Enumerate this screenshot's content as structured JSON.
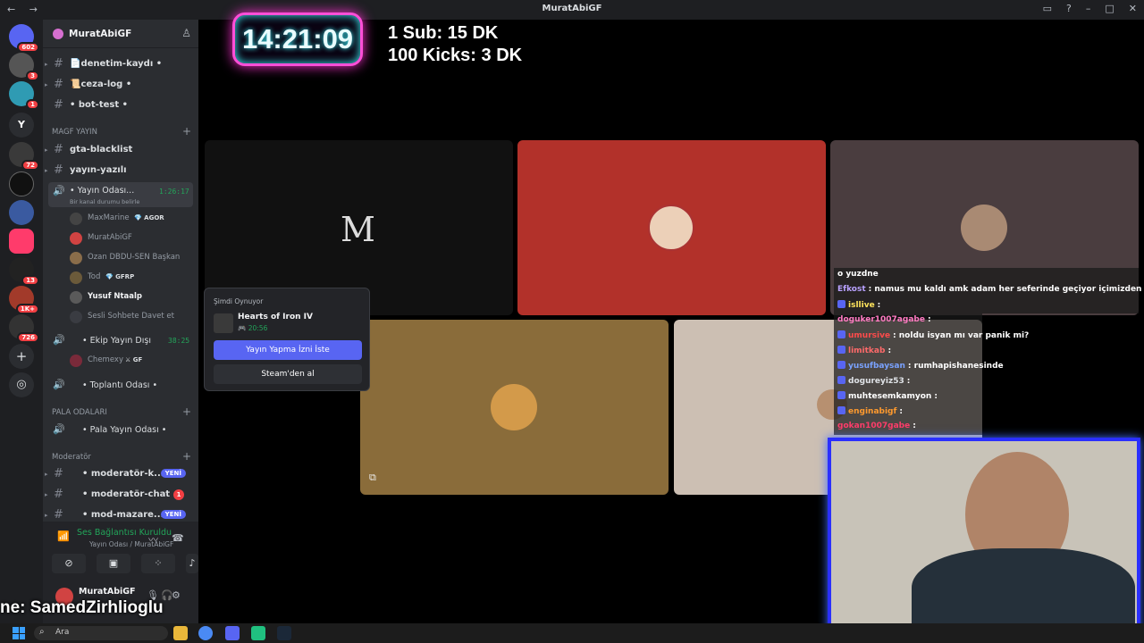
{
  "window": {
    "title": "MuratAbiGF",
    "nav": "← →"
  },
  "rail": {
    "badges": [
      "602",
      "3",
      "1",
      "72",
      "13",
      "1K+",
      "726"
    ],
    "letter": "Y"
  },
  "server": {
    "name": "MuratAbiGF"
  },
  "channels": {
    "top": [
      {
        "label": "📄denetim-kaydı •"
      },
      {
        "label": "📜ceza-log •"
      },
      {
        "label": "• bot-test •"
      }
    ],
    "category_magf": "MAGF YAYIN",
    "magf": [
      {
        "label": "gta-blacklist"
      },
      {
        "label": "yayın-yazılı"
      }
    ],
    "voice_yayin": {
      "label": "• Yayın Odası...",
      "timer": "1:26:17",
      "status": "Bir kanal durumu belirle"
    },
    "members": [
      {
        "name": "MaxMarine",
        "tag": "💎 AGOR"
      },
      {
        "name": "MuratAbiGF",
        "tag": ""
      },
      {
        "name": "Ozan DBDU-SEN Başkan",
        "tag": ""
      },
      {
        "name": "Tod",
        "tag": "💎 GFRP"
      },
      {
        "name": "Yusuf Ntaalp",
        "tag": ""
      },
      {
        "name": "Sesli Sohbete Davet et",
        "tag": ""
      }
    ],
    "voice_ekip": {
      "label": "• Ekip Yayın Dışı",
      "timer": "38:25"
    },
    "ekip_member": {
      "name": "Chemexy",
      "tag": "⚔ GF"
    },
    "voice_toplanti": {
      "label": "• Toplantı Odası •"
    },
    "category_pala": "PALA ODALARI",
    "voice_pala": {
      "label": "• Pala Yayın Odası •"
    },
    "category_mod": "Moderatör",
    "mod": [
      {
        "label": "• moderatör-k...",
        "badge": "YENİ"
      },
      {
        "label": "• moderatör-chat",
        "badge": "1"
      },
      {
        "label": "• mod-mazare...",
        "badge": "YENİ"
      }
    ]
  },
  "voice_panel": {
    "status": "Ses Bağlantısı Kuruldu",
    "sub": "Yayın Odası / MuratAbiGF",
    "user": "MuratAbiGF"
  },
  "overlay": {
    "name": "ne: SamedZirhlioglu",
    "clock": "14:21:09",
    "goal1": "1 Sub: 15 DK",
    "goal2": "100 Kicks: 3 DK"
  },
  "popup": {
    "heading": "Şimdi Oynuyor",
    "game": "Hearts of Iron IV",
    "time": "🎮 20:56",
    "primary": "Yayın Yapma İzni İste",
    "secondary": "Steam'den al"
  },
  "tiles": {
    "m_letter": "M"
  },
  "chat": [
    {
      "user": "",
      "text": "o yuzdne",
      "color": "#ffffff"
    },
    {
      "user": "Efkost",
      "text": ": namus mu kaldı amk adam her seferinde geçiyor içimizden",
      "color": "#b9a2ff"
    },
    {
      "user": "isllive",
      "text": ":",
      "color": "#ffe45c"
    },
    {
      "user": "doguker1007agabe",
      "text": ":",
      "color": "#ff7ac2"
    },
    {
      "user": "umursive",
      "text": ": noldu isyan mı var panik mi?",
      "color": "#ff4b4b"
    },
    {
      "user": "limitkab",
      "text": ":",
      "color": "#ff6a6a"
    },
    {
      "user": "yusufbaysan",
      "text": ": rumhapishanesinde",
      "color": "#7aa2ff"
    },
    {
      "user": "dogureyiz53",
      "text": ":",
      "color": "#dfe2e6"
    },
    {
      "user": "muhtesemkamyon",
      "text": ":",
      "color": "#ffffff"
    },
    {
      "user": "enginabigf",
      "text": ":",
      "color": "#ff9a2e"
    },
    {
      "user": "gokan1007gabe",
      "text": ":",
      "color": "#ff3d6a"
    }
  ],
  "taskbar": {
    "search": "Ara"
  },
  "colors": {
    "accent": "#5865f2",
    "online": "#23a55a",
    "danger": "#f23f43"
  }
}
